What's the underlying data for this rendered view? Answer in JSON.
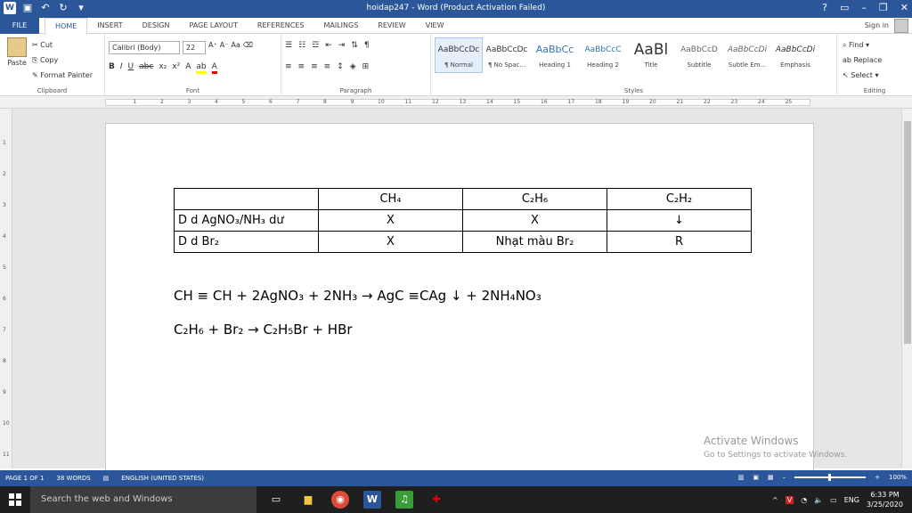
{
  "window": {
    "title": "hoidap247 - Word (Product Activation Failed)",
    "help": "?",
    "sign_in": "Sign in"
  },
  "tabs": [
    "FILE",
    "HOME",
    "INSERT",
    "DESIGN",
    "PAGE LAYOUT",
    "REFERENCES",
    "MAILINGS",
    "REVIEW",
    "VIEW"
  ],
  "ribbon": {
    "clipboard": {
      "paste": "Paste",
      "cut": "Cut",
      "copy": "Copy",
      "format_painter": "Format Painter",
      "label": "Clipboard"
    },
    "font": {
      "name": "Calibri (Body)",
      "size": "22",
      "label": "Font"
    },
    "paragraph": {
      "label": "Paragraph"
    },
    "styles": {
      "label": "Styles",
      "items": [
        {
          "preview": "AaBbCcDc",
          "name": "¶ Normal"
        },
        {
          "preview": "AaBbCcDc",
          "name": "¶ No Spac..."
        },
        {
          "preview": "AaBbCc",
          "name": "Heading 1"
        },
        {
          "preview": "AaBbCcC",
          "name": "Heading 2"
        },
        {
          "preview": "AaBl",
          "name": "Title"
        },
        {
          "preview": "AaBbCcD",
          "name": "Subtitle"
        },
        {
          "preview": "AaBbCcDi",
          "name": "Subtle Em..."
        },
        {
          "preview": "AaBbCcDi",
          "name": "Emphasis"
        }
      ]
    },
    "editing": {
      "find": "Find",
      "replace": "Replace",
      "select": "Select",
      "label": "Editing"
    }
  },
  "document": {
    "table": {
      "header": [
        "",
        "CH₄",
        "C₂H₆",
        "C₂H₂"
      ],
      "rows": [
        [
          "D d AgNO₃/NH₃ dư",
          "X",
          "X",
          "↓"
        ],
        [
          "D d Br₂",
          "X",
          "Nhạt màu Br₂",
          "R"
        ]
      ]
    },
    "equations": [
      "CH ≡ CH + 2AgNO₃ + 2NH₃ → AgC ≡CAg ↓ + 2NH₄NO₃",
      "C₂H₆ + Br₂ → C₂H₅Br + HBr"
    ]
  },
  "watermark": {
    "title": "Activate Windows",
    "subtitle": "Go to Settings to activate Windows."
  },
  "status": {
    "page": "PAGE 1 OF 1",
    "words": "38 WORDS",
    "language": "ENGLISH (UNITED STATES)",
    "zoom": "100%"
  },
  "taskbar": {
    "search": "Search the web and Windows",
    "lang": "ENG",
    "time": "6:33 PM",
    "date": "3/25/2020"
  }
}
